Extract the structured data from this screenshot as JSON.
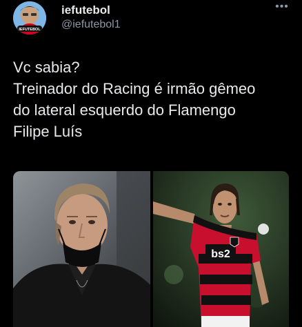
{
  "tweet": {
    "author": {
      "display_name": "iefutebol",
      "handle": "@iefutebol1",
      "avatar_badge": "IEFUTEBOL"
    },
    "more_icon": "more-dots-icon",
    "text_lines": [
      "Vc sabia?",
      "Treinador do Racing é irmão gêmeo",
      "do lateral esquerdo do Flamengo",
      "Filipe Luís"
    ],
    "media": {
      "images": [
        {
          "description_name": "coach-photo"
        },
        {
          "description_name": "player-photo",
          "jersey_sponsor": "bs2"
        }
      ]
    }
  },
  "colors": {
    "background": "#000000",
    "text": "#e7e9ea",
    "secondary": "#8b98a5",
    "flamengo_red": "#c8102e"
  }
}
